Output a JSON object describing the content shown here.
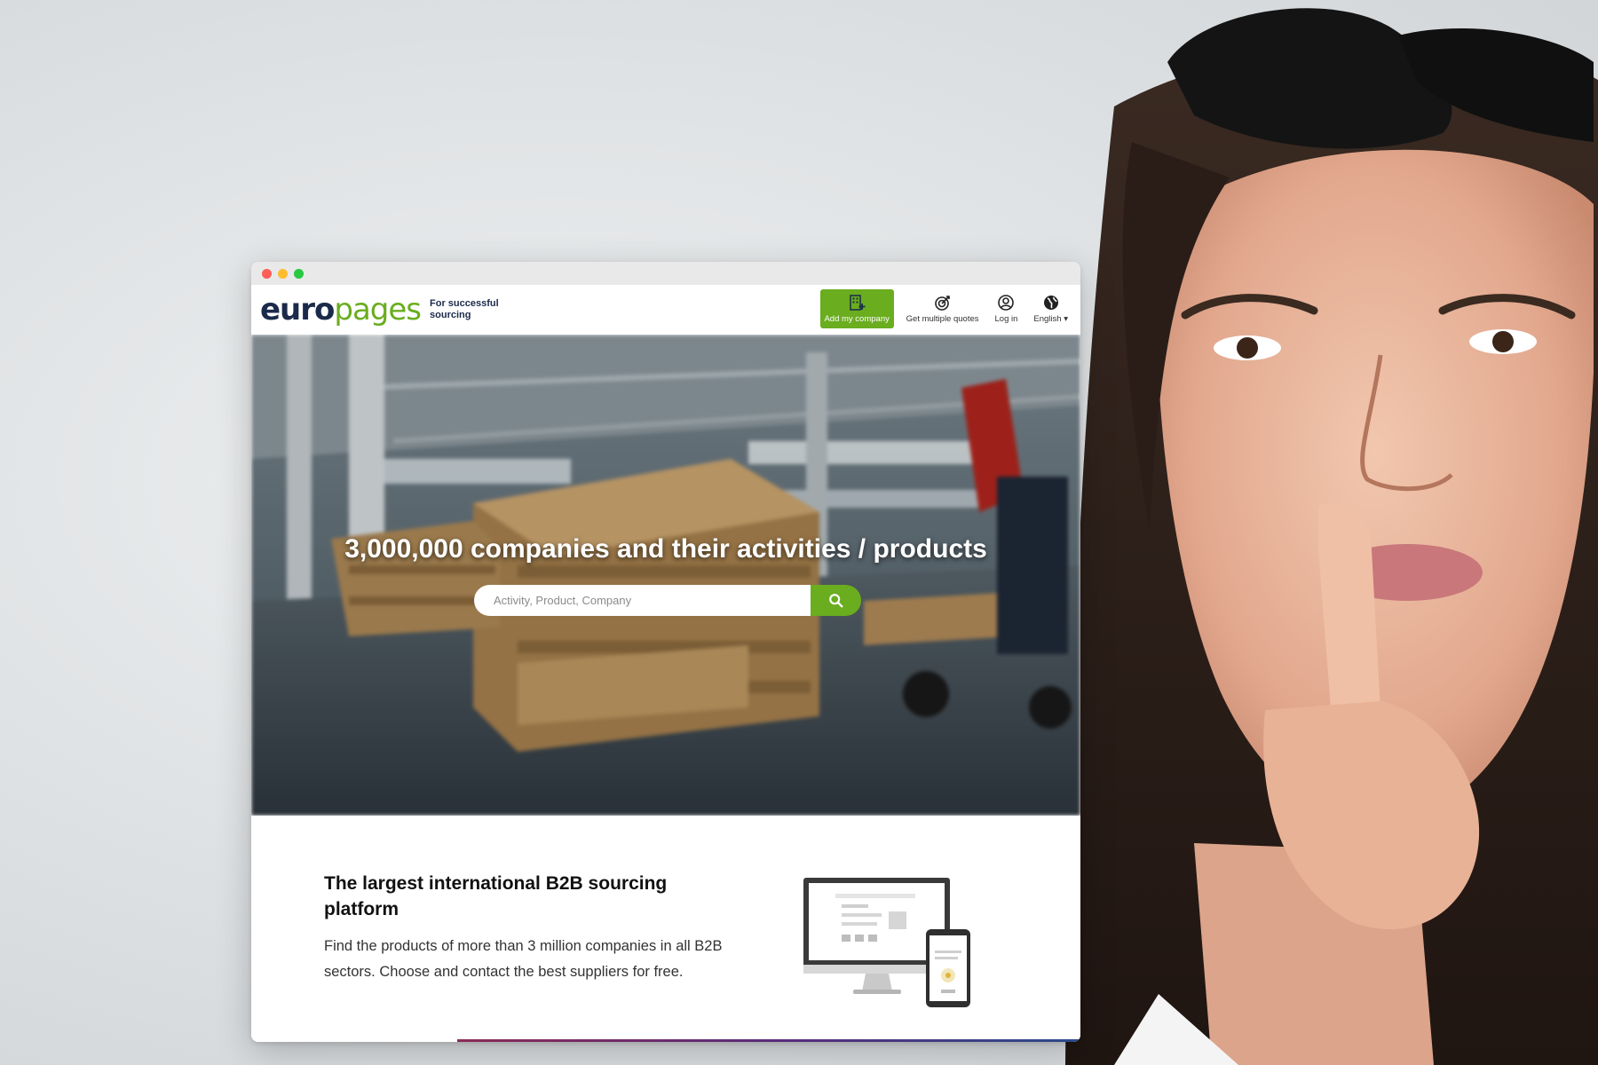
{
  "browser": {
    "site": {
      "logo_euro": "euro",
      "logo_pages": "pages",
      "tagline": "For successful sourcing",
      "nav": {
        "add_company": "Add my company",
        "quotes": "Get multiple quotes",
        "login": "Log in",
        "language": "English"
      },
      "hero": {
        "title": "3,000,000 companies and their activities / products",
        "search_placeholder": "Activity, Product, Company"
      },
      "content": {
        "heading": "The largest international B2B sourcing platform",
        "body": "Find the products of more than 3 million companies in all B2B sectors. Choose and contact the best suppliers for free."
      }
    }
  },
  "colors": {
    "brand_green": "#6aad1f",
    "brand_navy": "#1b2a4a"
  },
  "icons": {
    "add_company": "building-plus-icon",
    "quotes": "target-icon",
    "login": "user-circle-icon",
    "language": "globe-icon",
    "search": "search-icon"
  }
}
